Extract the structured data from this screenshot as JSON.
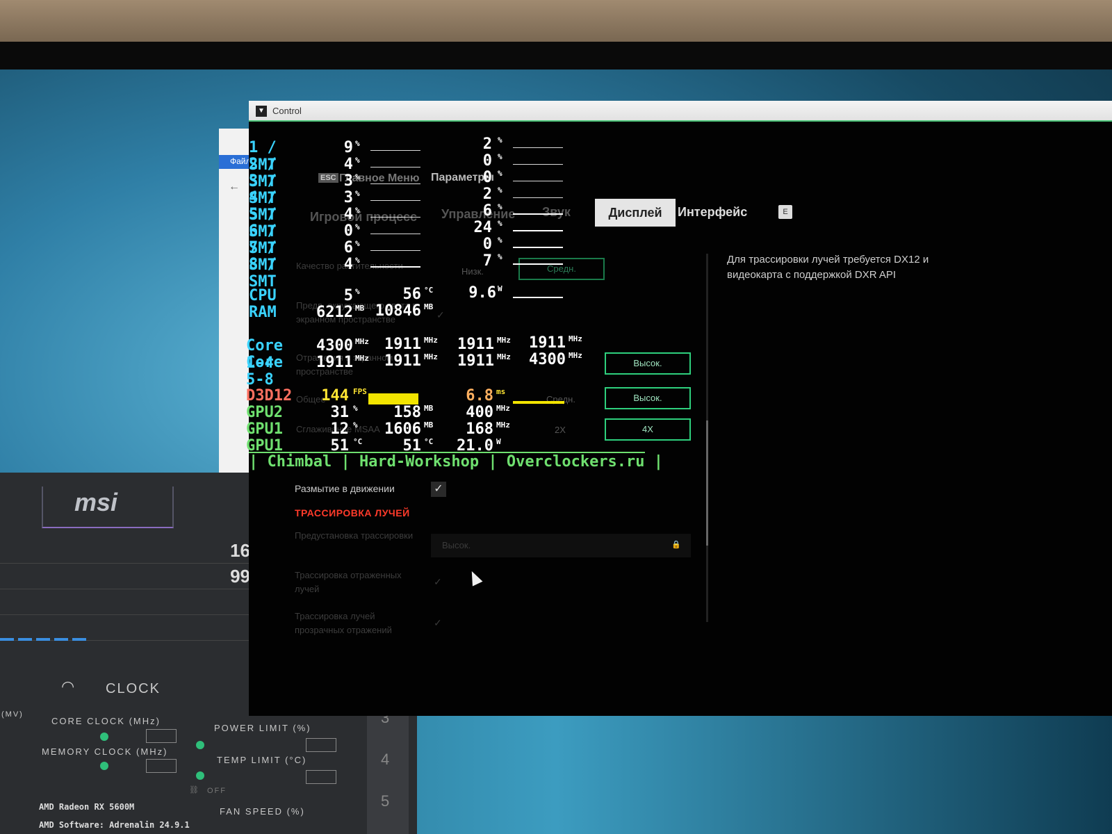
{
  "window": {
    "title": "Control"
  },
  "explorer": {
    "menu_label": "Файл"
  },
  "menu": {
    "esc_key": "ESC",
    "main_menu": "Главное Меню",
    "settings": "Параметры",
    "tabs": [
      "Игровой процесс",
      "Управление",
      "Звук",
      "Дисплей",
      "Интерфейс"
    ],
    "active_tab": "Дисплей",
    "next_key": "E"
  },
  "settings_panel": {
    "vegetation_label": "Качество растительности",
    "vegetation_low": "Низк.",
    "vegetation_mid": "Средн.",
    "ao_label": "Предв. окружающего света в экранном пространстве",
    "ssr_label": "Отражения в экранном пространстве",
    "ssr_value": "Высок.",
    "global_label": "Общее",
    "global_mid": "Средн.",
    "global_value": "Высок.",
    "msaa_label": "Сглаживание MSAA",
    "msaa_2x": "2X",
    "msaa_value": "4X",
    "motion_blur_label": "Размытие в движении",
    "motion_blur_checked": true,
    "raytracing_section": "ТРАССИРОВКА ЛУЧЕЙ",
    "rt_preset_label": "Предустановка трассировки",
    "rt_preset_value": "Высок.",
    "rt_reflections_label": "Трассировка отраженных лучей",
    "rt_transparent_label": "Трассировка лучей прозрачных отражений",
    "description": "Для трассировки лучей требуется DX12 и видеокарта с поддержкой DXR API"
  },
  "osd": {
    "threads": [
      {
        "label": "1 / SMT",
        "a": "9",
        "b": "2"
      },
      {
        "label": "2 / SMT",
        "a": "4",
        "b": "0"
      },
      {
        "label": "3 / SMT",
        "a": "3",
        "b": "0"
      },
      {
        "label": "4 / SMT",
        "a": "3",
        "b": "2"
      },
      {
        "label": "5 / SMT",
        "a": "4",
        "b": "6"
      },
      {
        "label": "6 / SMT",
        "a": "0",
        "b": "24"
      },
      {
        "label": "7 / SMT",
        "a": "6",
        "b": "0"
      },
      {
        "label": "8 / SMT",
        "a": "4",
        "b": "7"
      }
    ],
    "percent_unit": "%",
    "cpu": {
      "label": "CPU",
      "load": "5",
      "temp": "56",
      "temp_unit": "°C",
      "power": "9.6",
      "power_unit": "W"
    },
    "ram": {
      "label": "RAM",
      "used": "6212",
      "used_unit": "MB",
      "total": "10846",
      "total_unit": "MB"
    },
    "core_rows": [
      {
        "label": "Core 1-4",
        "values": [
          "4300",
          "1911",
          "1911",
          "1911"
        ]
      },
      {
        "label": "Core 5-8",
        "values": [
          "1911",
          "1911",
          "1911",
          "4300"
        ]
      }
    ],
    "mhz_unit": "MHz",
    "d3d": {
      "label": "D3D12",
      "fps": "144",
      "fps_unit": "FPS",
      "frametime": "6.8",
      "frametime_unit": "ms"
    },
    "gpu2": {
      "label": "GPU2",
      "load": "31",
      "load_unit": "%",
      "mem": "158",
      "mem_unit": "MB",
      "clock": "400",
      "clock_unit": "MHz"
    },
    "gpu1a": {
      "label": "GPU1",
      "load": "12",
      "load_unit": "%",
      "mem": "1606",
      "mem_unit": "MB",
      "clock": "168",
      "clock_unit": "MHz"
    },
    "gpu1b": {
      "label": "GPU1",
      "temp1": "51",
      "temp1_unit": "°C",
      "temp2": "51",
      "temp2_unit": "°C",
      "power": "21.0",
      "power_unit": "W"
    },
    "footer": "| Chimbal | Hard-Workshop | Overclockers.ru |"
  },
  "msi": {
    "logo": "msi",
    "values": [
      "16",
      "99"
    ],
    "clock_title": "CLOCK",
    "core_clock": "CORE CLOCK (MHz)",
    "memory_clock": "MEMORY CLOCK (MHz)",
    "power_limit": "POWER LIMIT (%)",
    "temp_limit": "TEMP LIMIT (°C)",
    "fan_speed": "FAN SPEED (%)",
    "mv_label": "(MV)",
    "gpu_name": "AMD Radeon RX 5600M",
    "software": "AMD Software: Adrenalin 24.9.1",
    "profiles": [
      "3",
      "4",
      "5"
    ],
    "off_label": "OFF"
  }
}
